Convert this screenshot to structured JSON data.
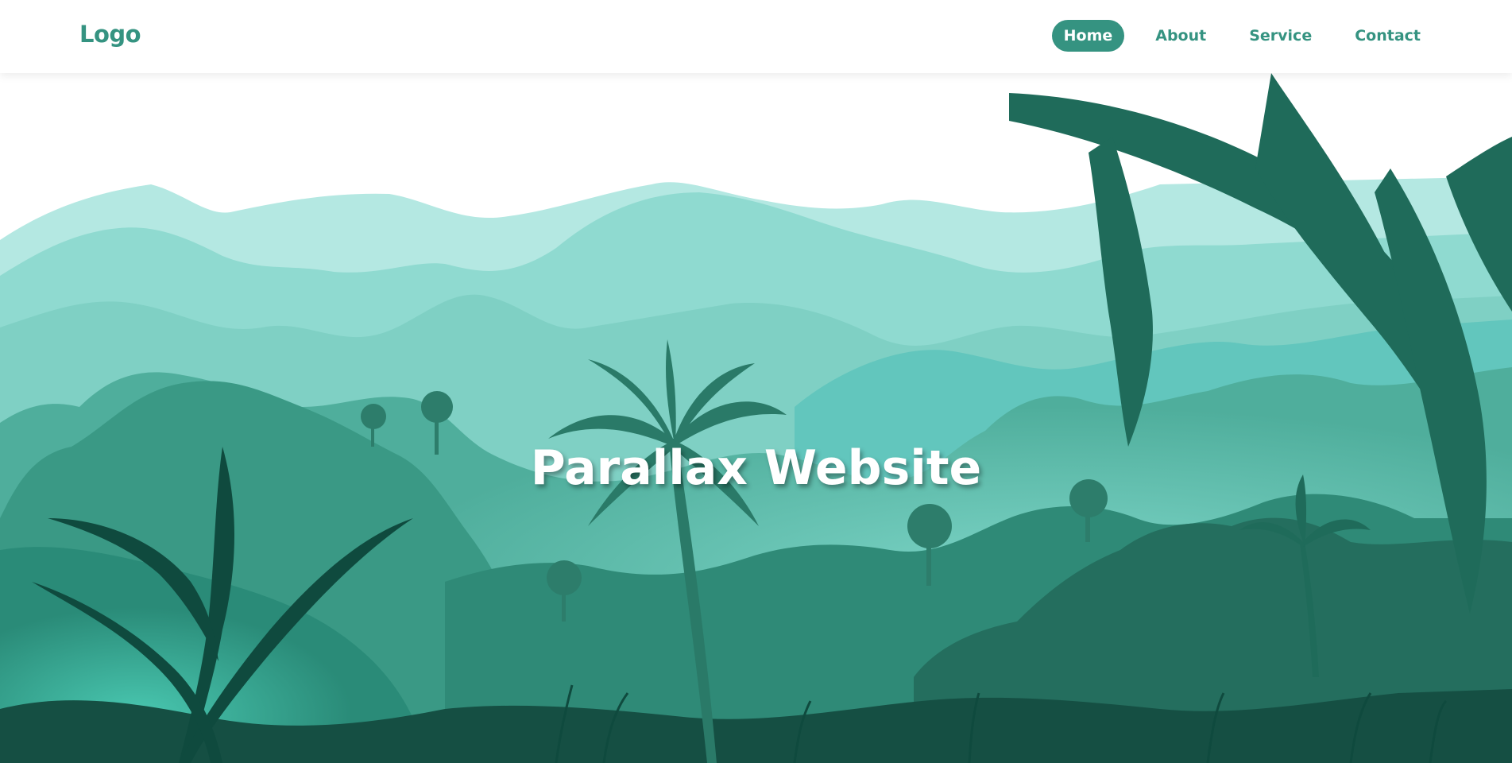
{
  "brand": {
    "logo": "Logo"
  },
  "nav": {
    "items": [
      {
        "label": "Home",
        "active": true
      },
      {
        "label": "About",
        "active": false
      },
      {
        "label": "Service",
        "active": false
      },
      {
        "label": "Contact",
        "active": false
      }
    ]
  },
  "hero": {
    "title": "Parallax Website"
  },
  "colors": {
    "accent": "#359381",
    "sky": "#ffffff",
    "far_hills": "#b4e8e2",
    "mid_hills": "#8fdad0",
    "forest": "#4fae9c",
    "deep_forest": "#1f6b5a",
    "dark_foliage": "#0f4a3e"
  }
}
